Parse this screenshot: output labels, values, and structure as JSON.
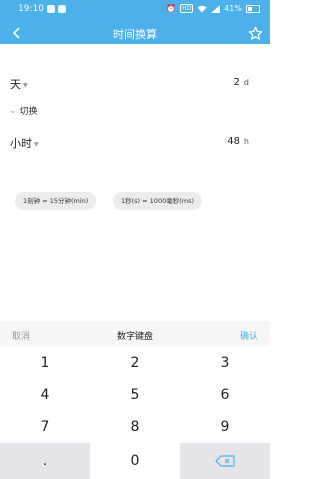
{
  "status_bar": {
    "time": "19:10",
    "hd": "HD",
    "battery": "41%"
  },
  "header": {
    "title": "时间换算"
  },
  "from": {
    "unit": "天",
    "value": "2",
    "suffix": "d"
  },
  "switch": {
    "label": "切换"
  },
  "to": {
    "unit": "小时",
    "value": "48",
    "suffix": "h"
  },
  "hints": [
    "1刻钟 = 15分钟(min)",
    "1秒(s) = 1000毫秒(ms)"
  ],
  "keyboard": {
    "cancel": "取消",
    "title": "数字键盘",
    "confirm": "确认",
    "keys": [
      "1",
      "2",
      "3",
      "4",
      "5",
      "6",
      "7",
      "8",
      "9",
      ".",
      "0"
    ]
  },
  "colors": {
    "accent": "#4cb0ea",
    "key_gray": "#e6e6ea"
  }
}
